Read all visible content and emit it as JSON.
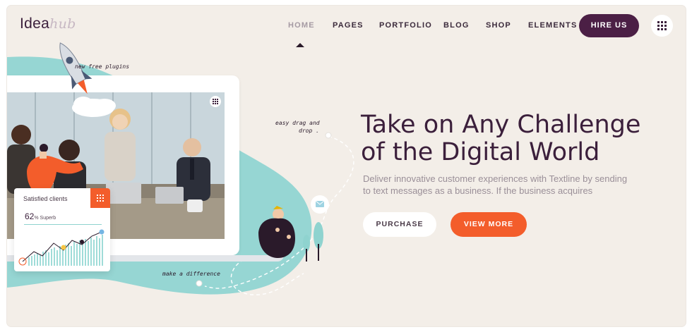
{
  "brand": {
    "logo_main": "Idea",
    "logo_accent": "hub"
  },
  "nav": {
    "items": [
      {
        "label": "HOME",
        "active": true
      },
      {
        "label": "PAGES"
      },
      {
        "label": "PORTFOLIO"
      },
      {
        "label": "BLOG"
      },
      {
        "label": "SHOP"
      },
      {
        "label": "ELEMENTS"
      }
    ],
    "cta": "HIRE US"
  },
  "hero": {
    "headline_line1": "Take on Any Challenge",
    "headline_line2": "of the Digital World",
    "subtext_line1": "Deliver innovative customer experiences with Textline by sending",
    "subtext_line2": "to text messages as a business. If the business acquires",
    "btn_purchase": "PURCHASE",
    "btn_view_more": "VIEW MORE"
  },
  "illustration": {
    "note_plugins": "new free plugins",
    "note_drag_1": "easy drag and",
    "note_drag_2": "drop .",
    "note_difference": "make a difference",
    "card_title": "Satisfied clients",
    "card_percent": "62",
    "card_percent_suffix": "% Superb"
  },
  "colors": {
    "brand_purple": "#4b1f45",
    "accent_orange": "#f35d2b",
    "teal": "#96d6d3",
    "background": "#f3eee8"
  }
}
